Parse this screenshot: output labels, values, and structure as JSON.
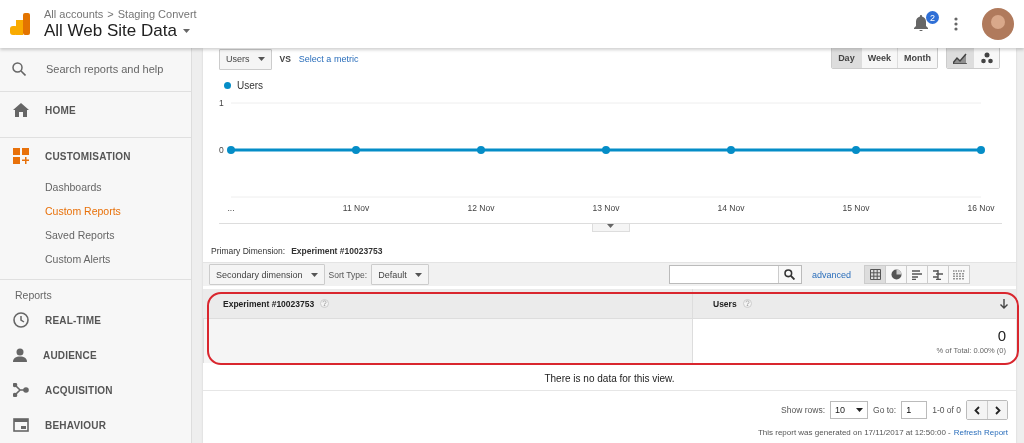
{
  "header": {
    "breadcrumb": [
      "All accounts",
      "Staging Convert"
    ],
    "separator": ">",
    "view_name": "All Web Site Data",
    "notification_count": "2"
  },
  "sidebar": {
    "search_placeholder": "Search reports and help",
    "top_items": [
      {
        "label": "HOME"
      },
      {
        "label": "CUSTOMISATION",
        "children": [
          {
            "label": "Dashboards",
            "selected": false
          },
          {
            "label": "Custom Reports",
            "selected": true
          },
          {
            "label": "Saved Reports",
            "selected": false
          },
          {
            "label": "Custom Alerts",
            "selected": false
          }
        ]
      }
    ],
    "reports_heading": "Reports",
    "report_items": [
      {
        "label": "REAL-TIME"
      },
      {
        "label": "AUDIENCE"
      },
      {
        "label": "ACQUISITION"
      },
      {
        "label": "BEHAVIOUR"
      }
    ]
  },
  "chart_panel": {
    "metric": "Users",
    "vs": "VS",
    "compare_link": "Select a metric",
    "periods": [
      {
        "label": "Day",
        "selected": true
      },
      {
        "label": "Week",
        "selected": false
      },
      {
        "label": "Month",
        "selected": false
      }
    ],
    "chart_types": [
      {
        "kind": "line",
        "selected": true
      },
      {
        "kind": "motion",
        "selected": false
      }
    ],
    "chart_data": {
      "type": "line",
      "categories": [
        "...",
        "11 Nov",
        "12 Nov",
        "13 Nov",
        "14 Nov",
        "15 Nov",
        "16 Nov"
      ],
      "series": [
        {
          "name": "Users",
          "color": "#058dc7",
          "marker": "o",
          "values": [
            0,
            0,
            0,
            0,
            0,
            0,
            0
          ]
        }
      ],
      "ylim": [
        -1,
        1
      ],
      "yticks": [
        0,
        1
      ]
    }
  },
  "table_section": {
    "primary_dimension_label": "Primary Dimension:",
    "primary_dimension": "Experiment #10023753",
    "secondary_dimension": "Secondary dimension",
    "sort_label": "Sort Type:",
    "sort_value": "Default",
    "advanced_link": "advanced",
    "views": [
      {
        "kind": "table",
        "selected": true
      },
      {
        "kind": "pie",
        "selected": false
      },
      {
        "kind": "bar",
        "selected": false
      },
      {
        "kind": "comparison",
        "selected": false
      },
      {
        "kind": "pivot",
        "selected": false
      }
    ],
    "columns": [
      {
        "label": "Experiment #10023753",
        "sorted": false
      },
      {
        "label": "Users",
        "sorted": true
      }
    ],
    "total": "0",
    "total_note": "% of Total: 0.00% (0)",
    "highlighted": true,
    "empty_message": "There is no data for this view.",
    "show_rows_label": "Show rows:",
    "show_rows": "10",
    "goto_label": "Go to:",
    "goto": "1",
    "range": "1-0 of 0",
    "generated_text": "This report was generated on 17/11/2017 at 12:50:00 -",
    "refresh_link": "Refresh Report"
  }
}
